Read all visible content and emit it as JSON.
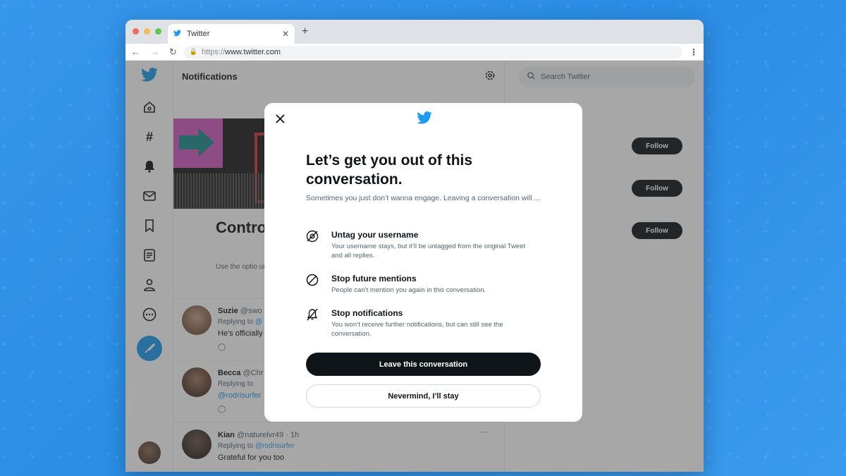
{
  "browser": {
    "tab_title": "Twitter",
    "url_proto": "https://",
    "url_host": "www.twitter.com"
  },
  "main": {
    "header_title": "Notifications",
    "promo_title": "Contro you're",
    "promo_sub": "Use the optio untag yoursel"
  },
  "feed": [
    {
      "name": "Suzie",
      "handle": "@swo",
      "reply_prefix": "Replying to",
      "reply_to": "@",
      "text": "He's officially"
    },
    {
      "name": "Becca",
      "handle": "@Chr",
      "reply_prefix": "Replying to",
      "reply_to": "@rodrisurfer",
      "text": ""
    },
    {
      "name": "Kian",
      "handle": "@naturelvr49 · 1h",
      "reply_prefix": "Replying to",
      "reply_to": "@rodrisurfer",
      "text": "Grateful for you too"
    }
  ],
  "right": {
    "search_placeholder": "Search Twitter",
    "follow_label": "Follow"
  },
  "modal": {
    "title": "Let’s get you out of this conversation.",
    "subtitle": "Sometimes you just don’t wanna engage. Leaving a conversation will ...",
    "options": [
      {
        "title": "Untag your username",
        "desc": "Your username stays, but it’ll be untagged from the original Tweet and all replies."
      },
      {
        "title": "Stop future mentions",
        "desc": "People can’t mention you again in this conversation."
      },
      {
        "title": "Stop notifications",
        "desc": "You won’t receive further notifications, but can still see the conversation."
      }
    ],
    "leave_label": "Leave this conversation",
    "stay_label": "Nevermind, I’ll stay"
  },
  "colors": {
    "twitter_blue": "#1d9bf0",
    "background_blue": "#2d8fe6",
    "primary_button": "#0f1419"
  }
}
